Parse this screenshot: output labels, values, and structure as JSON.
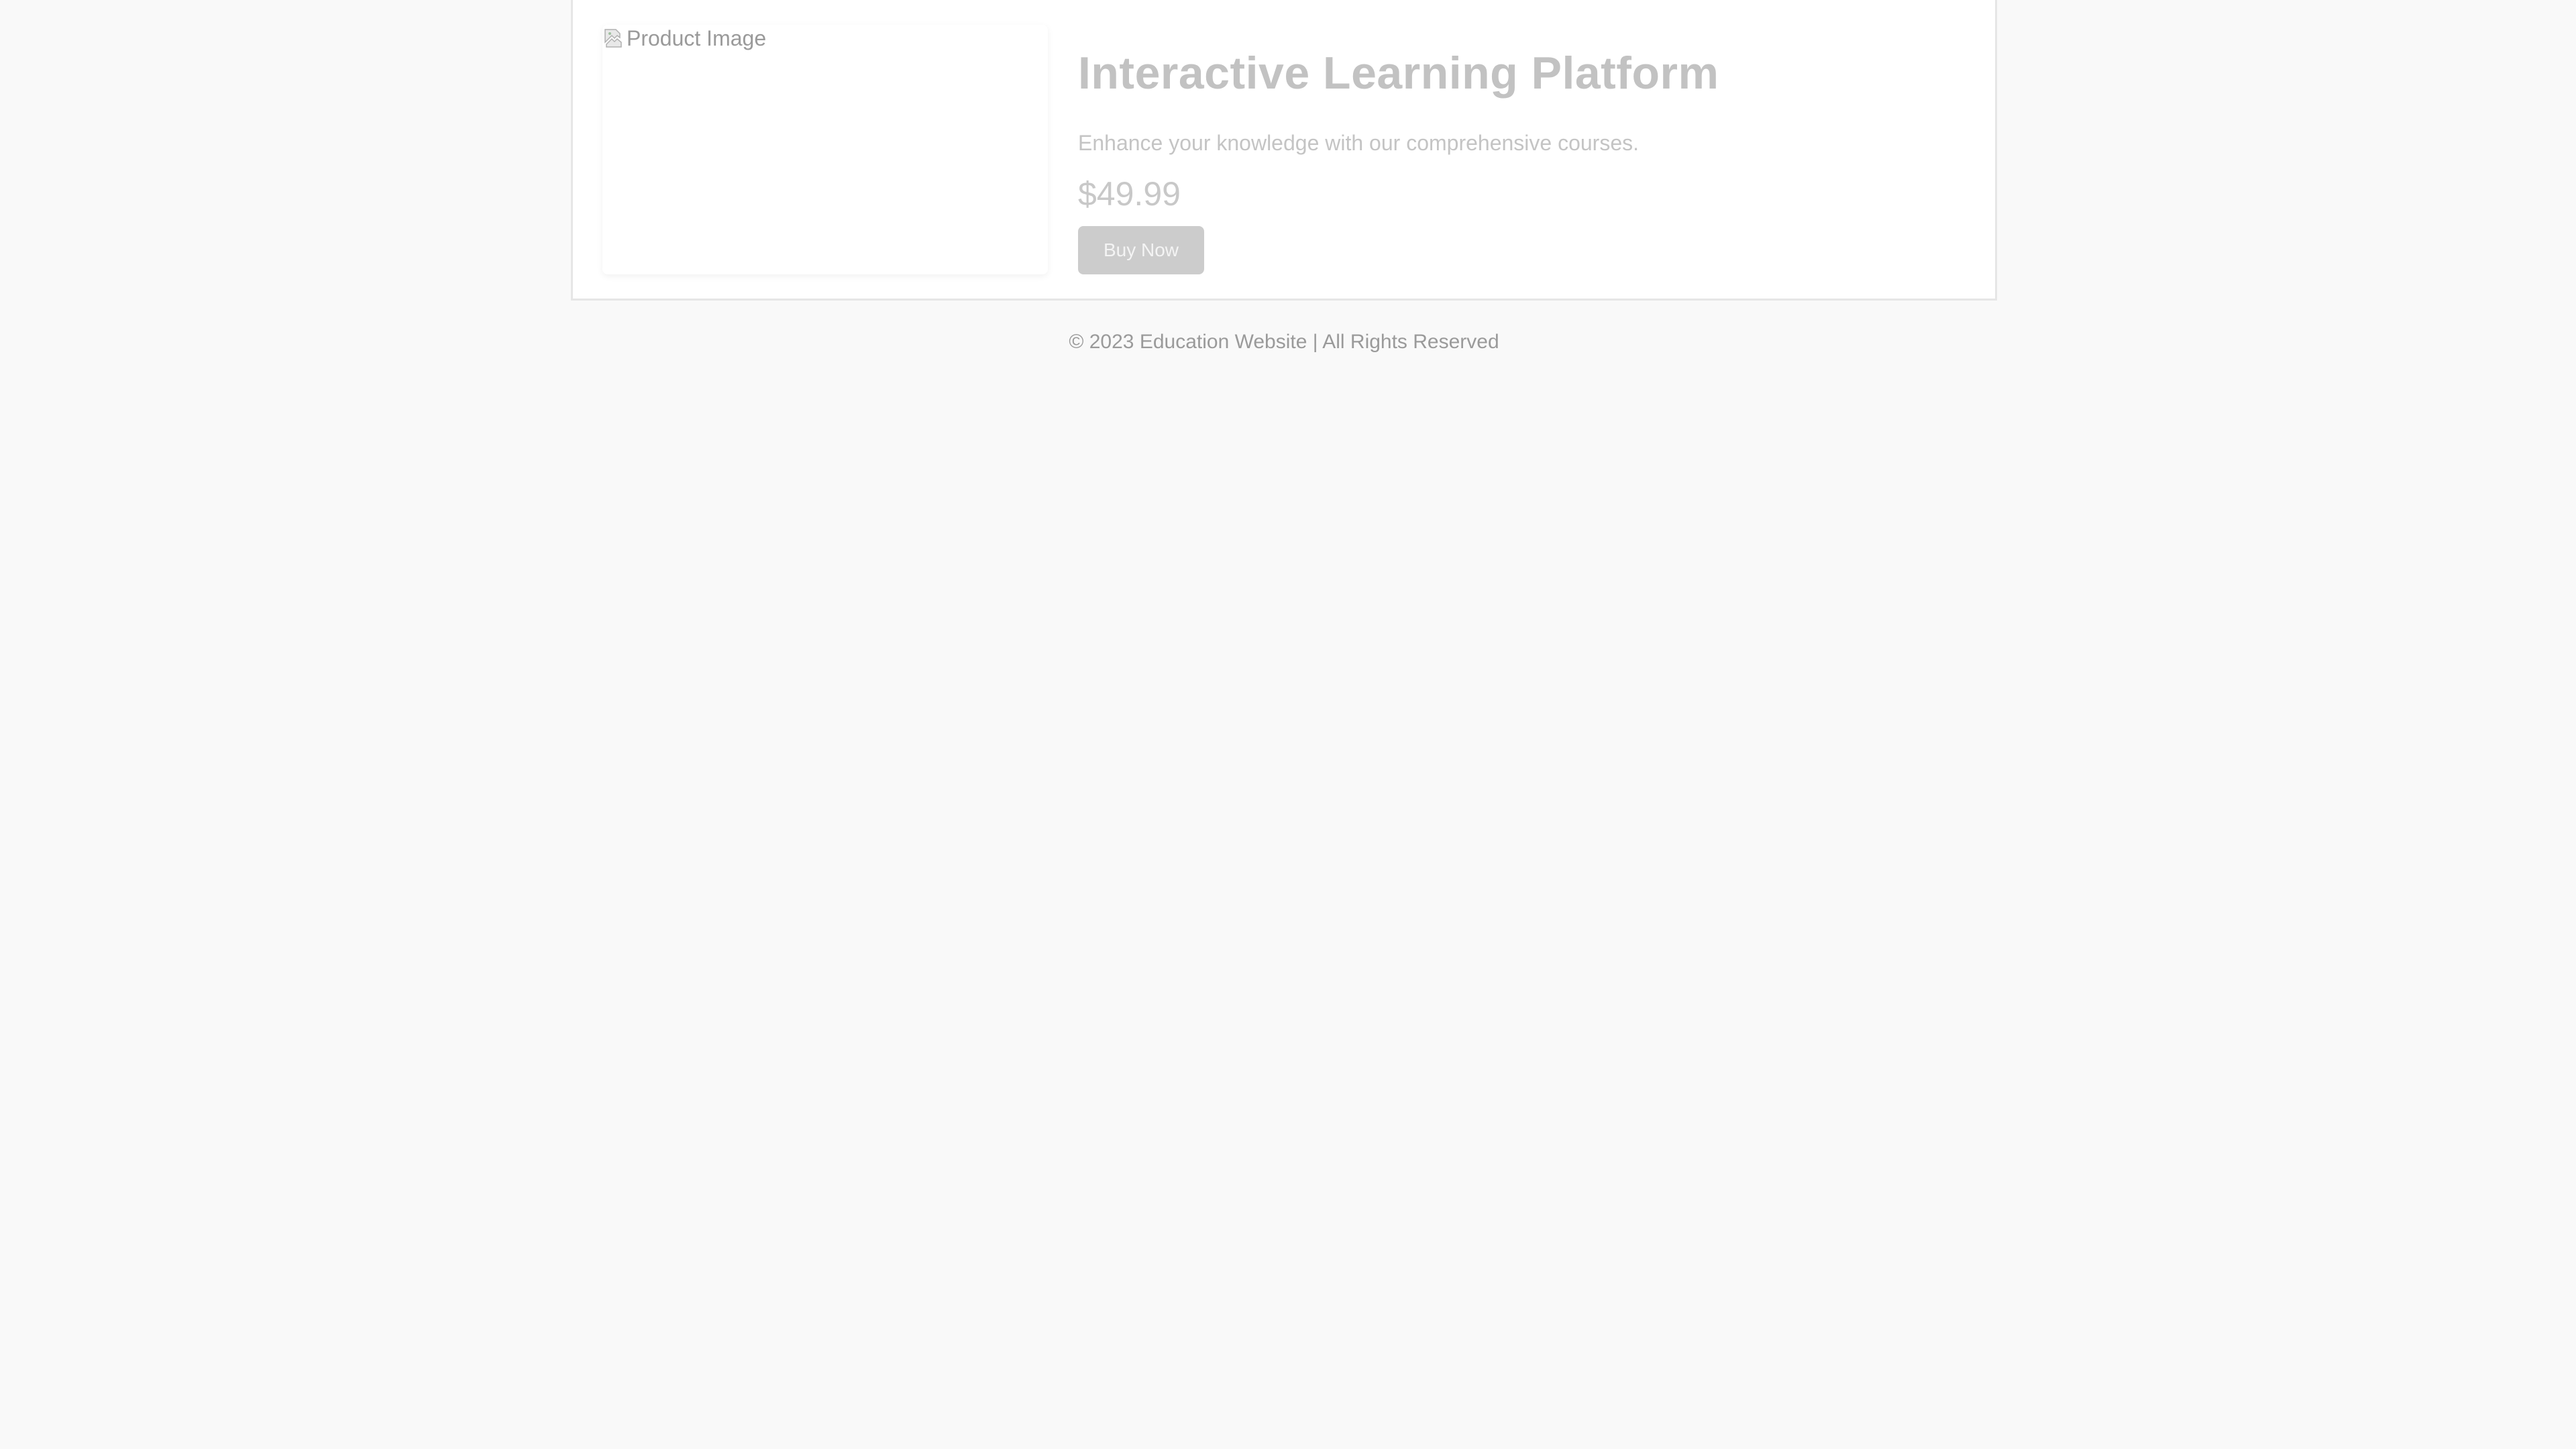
{
  "product": {
    "image_alt": "Product Image",
    "image_icon": "broken-image-icon",
    "title": "Interactive Learning Platform",
    "description": "Enhance your knowledge with our comprehensive courses.",
    "price": "$49.99",
    "buy_label": "Buy Now"
  },
  "footer": {
    "text": "© 2023 Education Website | All Rights Reserved"
  },
  "colors": {
    "background": "#f9f9f9",
    "card": "#ffffff",
    "title": "#c2c2c2",
    "button": "#cccccc",
    "footer_text": "#9a9a9a"
  }
}
